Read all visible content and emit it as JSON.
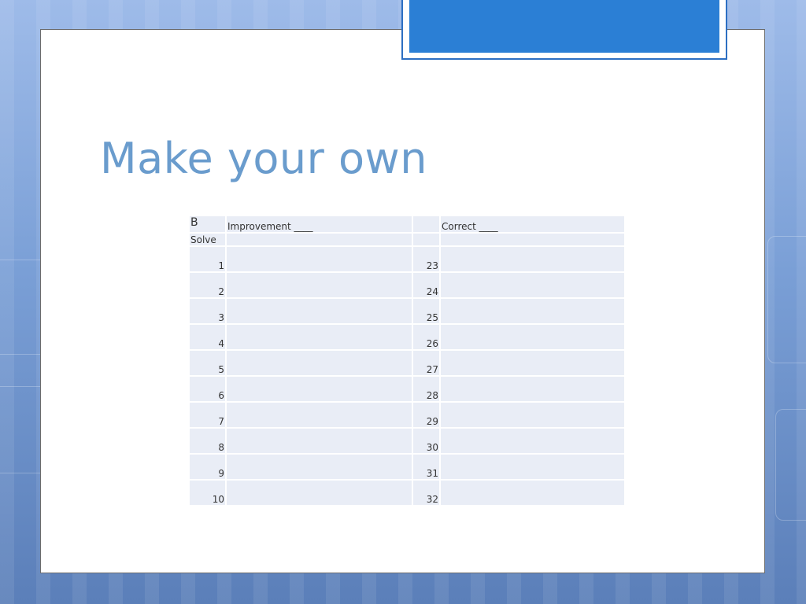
{
  "slide": {
    "title": "Make your own"
  },
  "table": {
    "header": {
      "col1": "B",
      "col2": "Improvement ____",
      "col3": "",
      "col4": "Correct ____"
    },
    "subheader": {
      "col1": "Solve"
    },
    "rows": [
      {
        "left": "1",
        "right": "23"
      },
      {
        "left": "2",
        "right": "24"
      },
      {
        "left": "3",
        "right": "25"
      },
      {
        "left": "4",
        "right": "26"
      },
      {
        "left": "5",
        "right": "27"
      },
      {
        "left": "6",
        "right": "28"
      },
      {
        "left": "7",
        "right": "29"
      },
      {
        "left": "8",
        "right": "30"
      },
      {
        "left": "9",
        "right": "31"
      },
      {
        "left": "10",
        "right": "32"
      }
    ]
  },
  "colors": {
    "title": "#6a9ccd",
    "accent": "#2b7fd5",
    "cell_fill": "#e9edf6"
  }
}
